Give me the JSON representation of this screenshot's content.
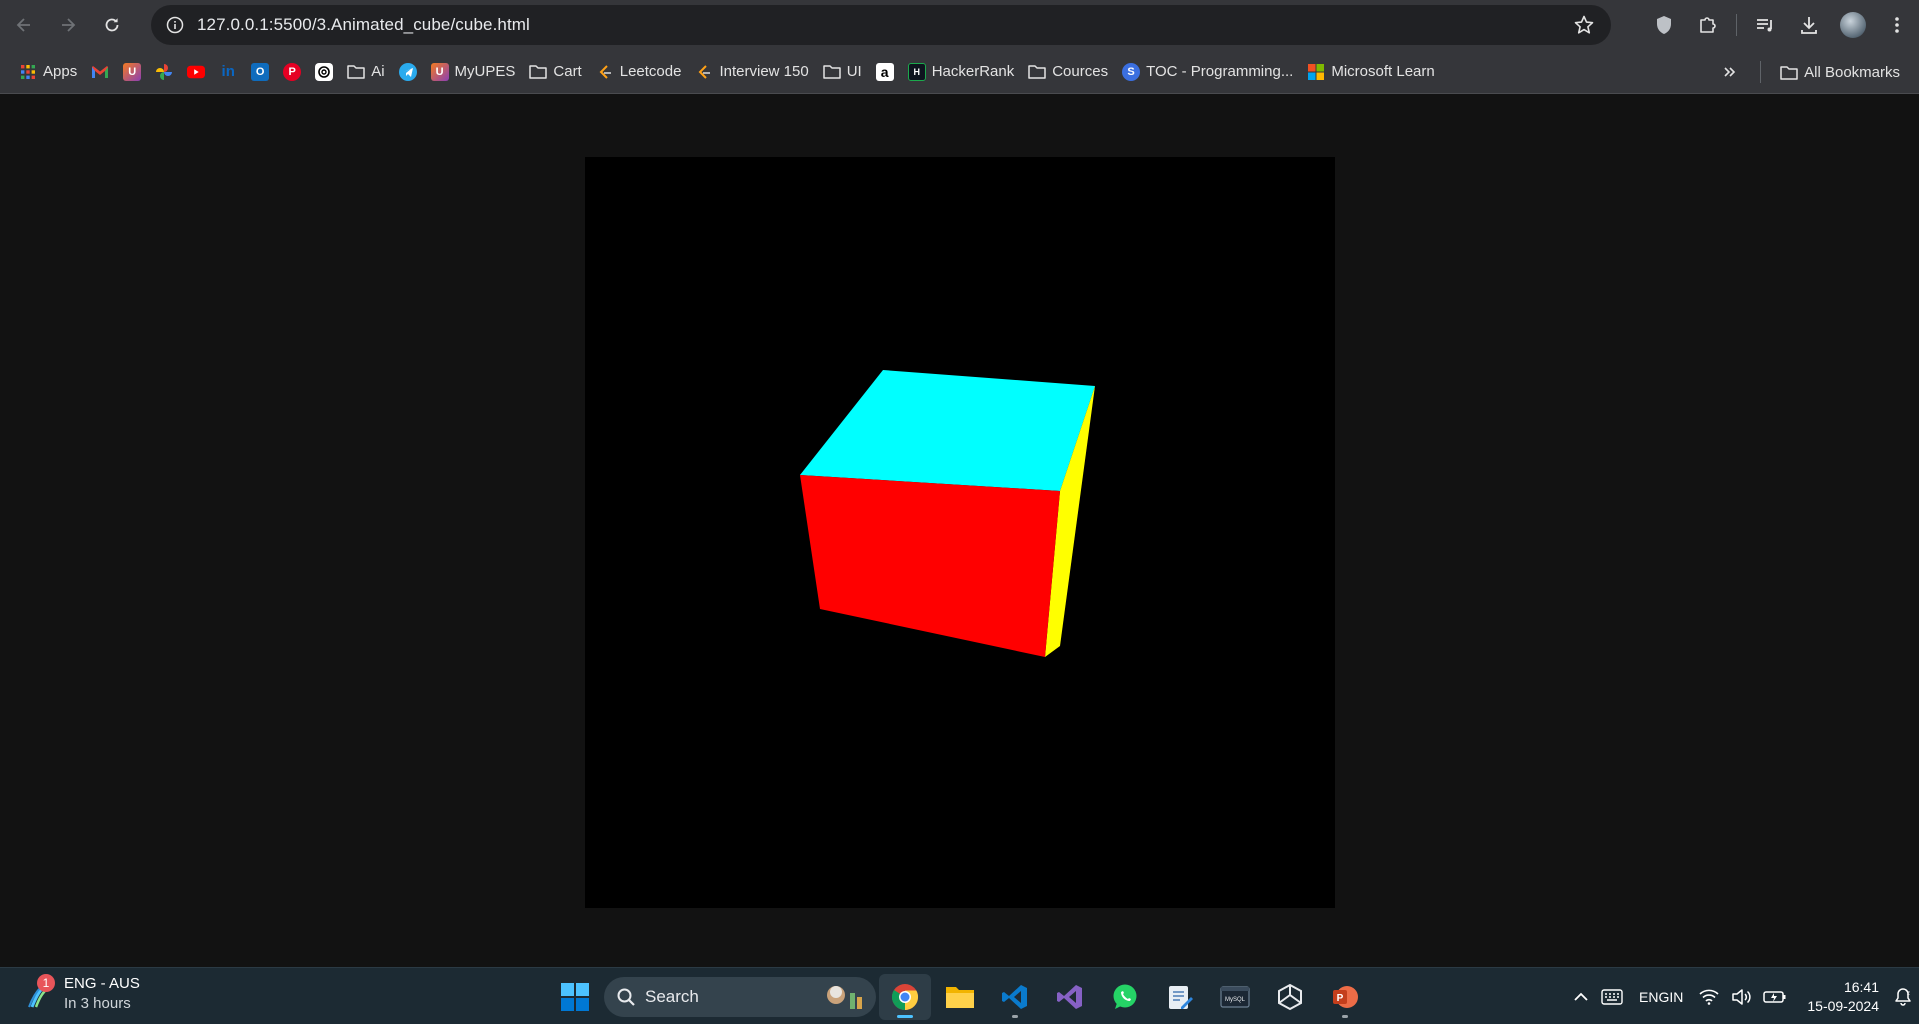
{
  "browser": {
    "url": "127.0.0.1:5500/3.Animated_cube/cube.html",
    "bookmarks": [
      {
        "label": "Apps",
        "icon": "apps-grid-icon"
      },
      {
        "label": "",
        "icon": "gmail-icon"
      },
      {
        "label": "",
        "icon": "myupes-icon"
      },
      {
        "label": "",
        "icon": "google-photos-icon"
      },
      {
        "label": "",
        "icon": "youtube-icon"
      },
      {
        "label": "",
        "icon": "linkedin-icon"
      },
      {
        "label": "",
        "icon": "outlook-icon"
      },
      {
        "label": "",
        "icon": "pinterest-icon"
      },
      {
        "label": "",
        "icon": "chatgpt-icon"
      },
      {
        "label": "Ai",
        "icon": "folder-icon"
      },
      {
        "label": "",
        "icon": "telegram-icon"
      },
      {
        "label": "MyUPES",
        "icon": "myupes-icon"
      },
      {
        "label": "Cart",
        "icon": "folder-icon"
      },
      {
        "label": "Leetcode",
        "icon": "leetcode-icon"
      },
      {
        "label": "Interview 150",
        "icon": "leetcode-icon"
      },
      {
        "label": "UI",
        "icon": "folder-icon"
      },
      {
        "label": "",
        "icon": "amazon-icon"
      },
      {
        "label": "HackerRank",
        "icon": "hackerrank-icon"
      },
      {
        "label": "Cources",
        "icon": "folder-icon"
      },
      {
        "label": "TOC - Programming...",
        "icon": "scaler-icon"
      },
      {
        "label": "Microsoft Learn",
        "icon": "microsoft-icon"
      }
    ],
    "all_bookmarks": "All Bookmarks"
  },
  "page": {
    "cube_colors": {
      "front": "#ff0000",
      "top": "#00ffff",
      "right": "#ffff00"
    },
    "canvas_background": "#000000",
    "page_background": "#121212"
  },
  "taskbar": {
    "weather": {
      "badge": "1",
      "line1": "ENG - AUS",
      "line2": "In 3 hours"
    },
    "search_label": "Search",
    "apps": [
      "chrome-icon",
      "file-explorer-icon",
      "vscode-icon",
      "visual-studio-icon",
      "whatsapp-icon",
      "notepad-icon",
      "mysql-icon",
      "unity-icon",
      "powerpoint-icon"
    ],
    "language": {
      "line1": "ENG",
      "line2": "IN"
    },
    "clock": {
      "time": "16:41",
      "date": "15-09-2024"
    }
  }
}
